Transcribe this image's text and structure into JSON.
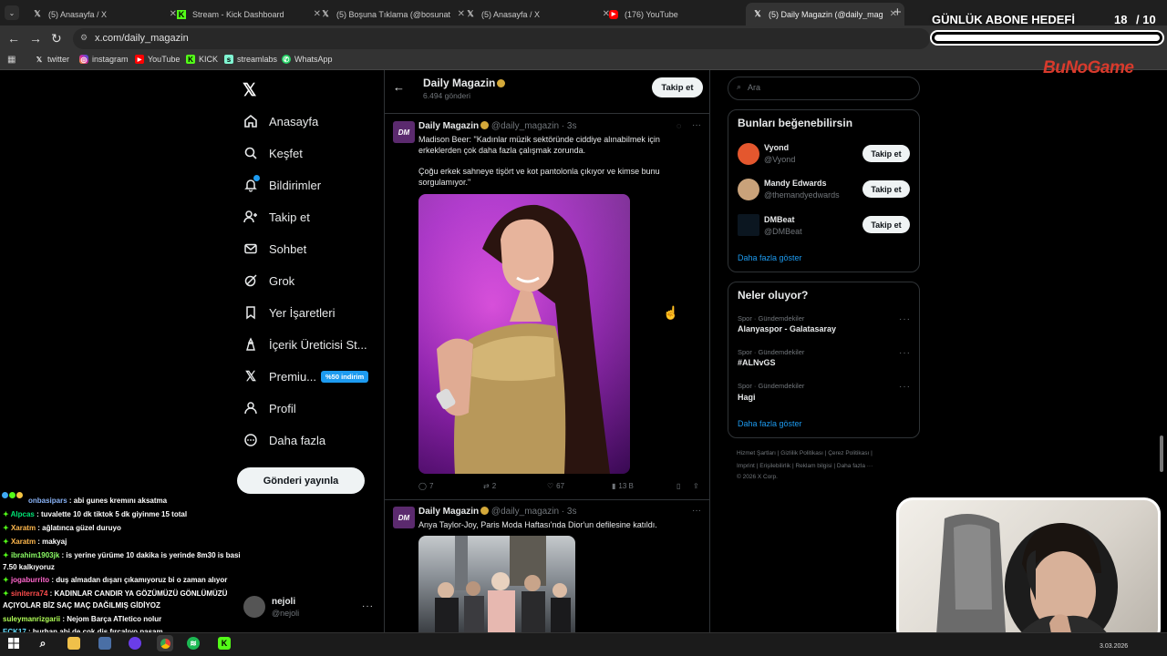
{
  "browser": {
    "tabs": [
      {
        "title": "(5) Anasayfa / X",
        "icon": "x-logo-icon",
        "active": false
      },
      {
        "title": "Stream - Kick Dashboard",
        "icon": "kick-logo-icon",
        "active": false
      },
      {
        "title": "(5) Boşuna Tıklama (@bosunat",
        "icon": "x-logo-icon",
        "active": false
      },
      {
        "title": "(5) Anasayfa / X",
        "icon": "x-logo-icon",
        "active": false
      },
      {
        "title": "(176) YouTube",
        "icon": "youtube-logo-icon",
        "active": false
      },
      {
        "title": "(5) Daily Magazin (@daily_mag",
        "icon": "x-logo-icon",
        "active": true
      }
    ],
    "url": "x.com/daily_magazin",
    "bookmarks": [
      {
        "label": "twitter",
        "icon": "x-logo-icon"
      },
      {
        "label": "instagram",
        "icon": "instagram-icon"
      },
      {
        "label": "YouTube",
        "icon": "youtube-logo-icon"
      },
      {
        "label": "KICK",
        "icon": "kick-logo-icon"
      },
      {
        "label": "streamlabs",
        "icon": "streamlabs-icon"
      },
      {
        "label": "WhatsApp",
        "icon": "whatsapp-icon"
      }
    ]
  },
  "overlay": {
    "goal_label": "GÜNLÜK ABONE HEDEFİ",
    "goal_current": "18",
    "goal_total": "/ 10",
    "logo_text": "BuNoGame"
  },
  "sidebar": {
    "items": [
      {
        "label": "Anasayfa",
        "icon": "home-icon"
      },
      {
        "label": "Keşfet",
        "icon": "search-icon"
      },
      {
        "label": "Bildirimler",
        "icon": "bell-icon"
      },
      {
        "label": "Takip et",
        "icon": "add-person-icon"
      },
      {
        "label": "Sohbet",
        "icon": "mail-icon"
      },
      {
        "label": "Grok",
        "icon": "grok-icon"
      },
      {
        "label": "Yer İşaretleri",
        "icon": "bookmark-icon"
      },
      {
        "label": "İçerik Üreticisi St...",
        "icon": "creator-studio-icon"
      },
      {
        "label": "Premiu...",
        "icon": "x-logo-icon",
        "badge": "%50 indirim"
      },
      {
        "label": "Profil",
        "icon": "person-icon"
      },
      {
        "label": "Daha fazla",
        "icon": "more-circle-icon"
      }
    ],
    "post_button": "Gönderi yayınla",
    "account": {
      "name": "nejoli",
      "handle": "@nejoli"
    }
  },
  "profile_header": {
    "name": "Daily Magazin",
    "posts": "6.494 gönderi",
    "follow_label": "Takip et"
  },
  "tweets": [
    {
      "name": "Daily Magazin",
      "handle": "@daily_magazin",
      "time": "3s",
      "text1": "Madison Beer: \"Kadınlar müzik sektöründe ciddiye alınabilmek için erkeklerden çok daha fazla çalışmak zorunda.",
      "text2": "Çoğu erkek sahneye tişört ve kot pantolonla çıkıyor ve kimse bunu sorgulamıyor.\"",
      "replies": "7",
      "retweets": "2",
      "likes": "67",
      "views": "13 B"
    },
    {
      "name": "Daily Magazin",
      "handle": "@daily_magazin",
      "time": "3s",
      "text1": "Anya Taylor-Joy, Paris Moda Haftası'nda Dior'un defilesine katıldı."
    }
  ],
  "right": {
    "search_placeholder": "Ara",
    "suggest_title": "Bunları beğenebilirsin",
    "suggestions": [
      {
        "name": "Vyond",
        "handle": "@Vyond",
        "avatar_color": "#e4572e"
      },
      {
        "name": "Mandy Edwards",
        "handle": "@themandyedwards",
        "avatar_color": "#c9a27a"
      },
      {
        "name": "DMBeat",
        "handle": "@DMBeat",
        "avatar_color": "#0b1620"
      }
    ],
    "follow_label": "Takip et",
    "show_more": "Daha fazla göster",
    "trends_title": "Neler oluyor?",
    "trends": [
      {
        "meta": "Spor · Gündemdekiler",
        "name": "Alanyaspor - Galatasaray"
      },
      {
        "meta": "Spor · Gündemdekiler",
        "name": "#ALNvGS"
      },
      {
        "meta": "Spor · Gündemdekiler",
        "name": "Hagi"
      }
    ],
    "footer1": [
      "Hizmet Şartları",
      "Gizlilik Politikası",
      "Çerez Politikası"
    ],
    "footer2": [
      "Imprint",
      "Erişilebilirlik",
      "Reklam bilgisi",
      "Daha fazla ···"
    ],
    "copyright": "© 2026 X Corp."
  },
  "chat": [
    {
      "user": "onbasipars",
      "text": " : abi gunes kremını aksatma",
      "color": "#8ab4f8"
    },
    {
      "user": "Alpcas",
      "text": " : tuvalette 10 dk tiktok 5 dk giyinme 15 total",
      "color": "#00e676"
    },
    {
      "user": "Xaratm",
      "text": " : ağlatınca güzel duruyo",
      "color": "#ffb84d"
    },
    {
      "user": "Xaratm",
      "text": " : makyaj",
      "color": "#ffb84d"
    },
    {
      "user": "ibrahim1903jk",
      "text": " : is yerine yürüme 10 dakika is yerinde 8m30 is basi",
      "color": "#8cff66"
    },
    {
      "user": "",
      "text": "7.50 kalkıyoruz",
      "color": "#ffffff"
    },
    {
      "user": "jogaburrito",
      "text": " : duş almadan dışarı çıkamıyoruz bi o zaman alıyor",
      "color": "#ff66cc"
    },
    {
      "user": "siniterra74",
      "text": " : KADINLAR CANDIR YA GÖZÜMÜZÜ GÖNLÜMÜZÜ",
      "color": "#ff4d4d"
    },
    {
      "user": "",
      "text": "AÇIYOLAR BİZ SAÇ MAÇ DAĞILMIŞ GİDİYOZ",
      "color": "#ffffff"
    },
    {
      "user": "suleymanrizgarii",
      "text": " : Nejom Barça ATletico nolur",
      "color": "#b0ff57"
    },
    {
      "user": "ECK17",
      "text": " : burhan abi de cok diş fırçalıyo paşam",
      "color": "#66e0ff"
    }
  ],
  "taskbar": {
    "date": "3.03.2026"
  }
}
